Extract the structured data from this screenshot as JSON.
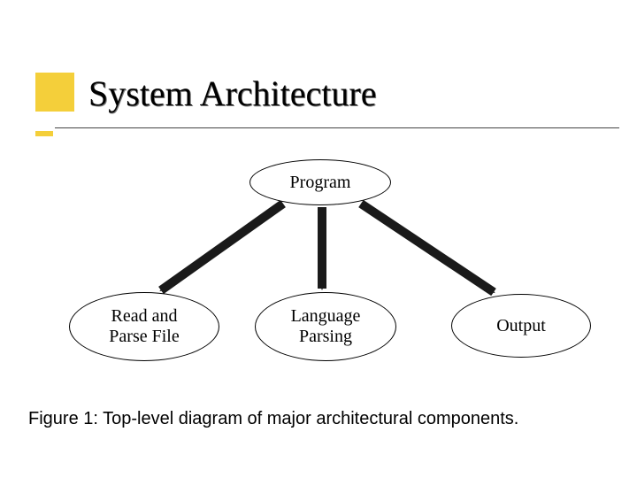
{
  "slide": {
    "title": "System Architecture",
    "caption": "Figure 1: Top-level diagram of major architectural components."
  },
  "diagram": {
    "root": {
      "label": "Program"
    },
    "children": [
      {
        "label": "Read and\nParse File"
      },
      {
        "label": "Language\nParsing"
      },
      {
        "label": "Output"
      }
    ]
  },
  "colors": {
    "accent": "#f4cf3a",
    "arrow_fill": "#1a1a1a"
  }
}
